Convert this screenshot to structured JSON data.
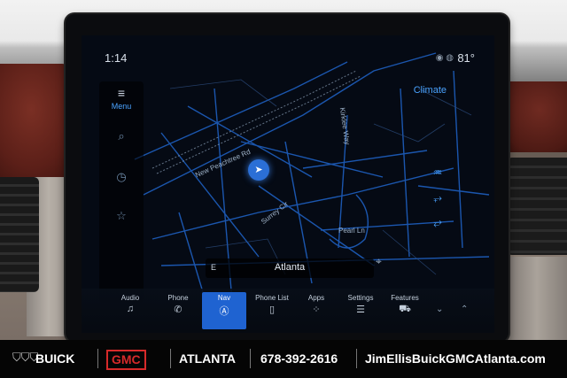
{
  "status": {
    "time": "1:14",
    "temperature": "81°"
  },
  "side_menu": {
    "menu_label": "Menu"
  },
  "climate": {
    "label": "Climate"
  },
  "map": {
    "street_labels": [
      "New Peachtree Rd",
      "Kirklee Way",
      "Surrey Cir",
      "Pearl Ln"
    ],
    "city": "Atlanta",
    "heading": "E"
  },
  "bottom_tabs": [
    {
      "label": "Audio",
      "icon": "music-note-icon"
    },
    {
      "label": "Phone",
      "icon": "phone-icon"
    },
    {
      "label": "Nav",
      "icon": "nav-a-icon"
    },
    {
      "label": "Phone List",
      "icon": "phone-list-icon"
    },
    {
      "label": "Apps",
      "icon": "apps-grid-icon"
    },
    {
      "label": "Settings",
      "icon": "sliders-icon"
    },
    {
      "label": "Features",
      "icon": "car-icon"
    }
  ],
  "active_tab": "Nav",
  "banner": {
    "brand_buick": "BUICK",
    "brand_gmc": "GMC",
    "city": "ATLANTA",
    "phone": "678-392-2616",
    "website": "JimEllisBuickGMCAtlanta.com"
  },
  "colors": {
    "accent": "#1f63d1",
    "map_road": "#1e5fbf",
    "screen_bg": "#050a14",
    "gmc_red": "#d62a2a"
  }
}
